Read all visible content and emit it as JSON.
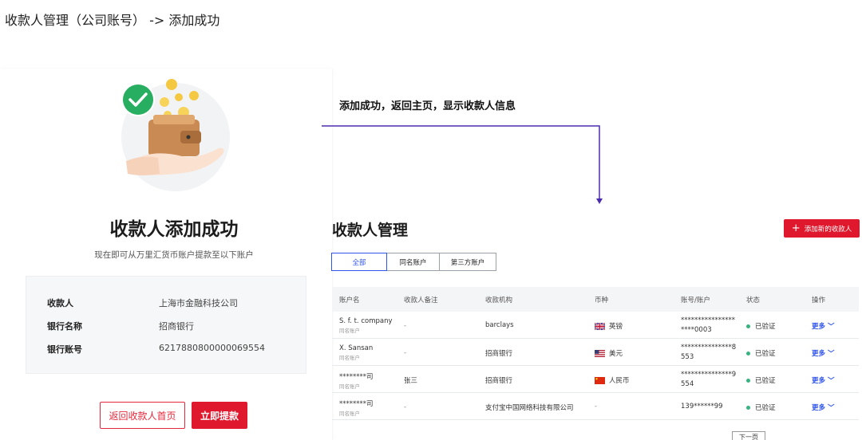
{
  "page_title": "收款人管理（公司账号） -> 添加成功",
  "annotation": "添加成功，返回主页，显示收款人信息",
  "success": {
    "title": "收款人添加成功",
    "subtitle": "现在即可从万里汇货币账户提款至以下账户",
    "fields": [
      {
        "label": "收款人",
        "value": "上海市金融科技公司"
      },
      {
        "label": "银行名称",
        "value": "招商银行"
      },
      {
        "label": "银行账号",
        "value": "6217880800000069554"
      }
    ],
    "back_button": "返回收款人首页",
    "withdraw_button": "立即提款"
  },
  "management": {
    "title": "收款人管理",
    "add_button": "添加新的收款人",
    "tabs": [
      {
        "label": "全部",
        "active": true
      },
      {
        "label": "同名账户",
        "active": false
      },
      {
        "label": "第三方账户",
        "active": false
      }
    ],
    "columns": [
      "账户名",
      "收款人备注",
      "收款机构",
      "币种",
      "账号/账户",
      "状态",
      "操作"
    ],
    "rows": [
      {
        "name": "S. f. t. company",
        "type": "同名账户",
        "note": "-",
        "institution": "barclays",
        "currency": "英镑",
        "flag": "uk-flag",
        "account_line1": "****************",
        "account_line2": "****0003",
        "status": "已验证",
        "action": "更多"
      },
      {
        "name": "X. Sansan",
        "type": "同名账户",
        "note": "-",
        "institution": "招商银行",
        "currency": "美元",
        "flag": "us-flag",
        "account_line1": "***************8",
        "account_line2": "553",
        "status": "已验证",
        "action": "更多"
      },
      {
        "name": "********司",
        "type": "同名账户",
        "note": "张三",
        "institution": "招商银行",
        "currency": "人民币",
        "flag": "cn-flag",
        "account_line1": "***************9",
        "account_line2": "554",
        "status": "已验证",
        "action": "更多"
      },
      {
        "name": "********司",
        "type": "同名账户",
        "note": "-",
        "institution": "支付宝中国网络科技有限公司",
        "currency": "-",
        "flag": "",
        "account_line1": "139******99",
        "account_line2": "",
        "status": "已验证",
        "action": "更多"
      }
    ],
    "next_page": "下一页"
  },
  "colors": {
    "accent_red": "#e0182d",
    "link_blue": "#2f54eb",
    "status_green": "#36b37e",
    "arrow_purple": "#4b2bb0"
  }
}
